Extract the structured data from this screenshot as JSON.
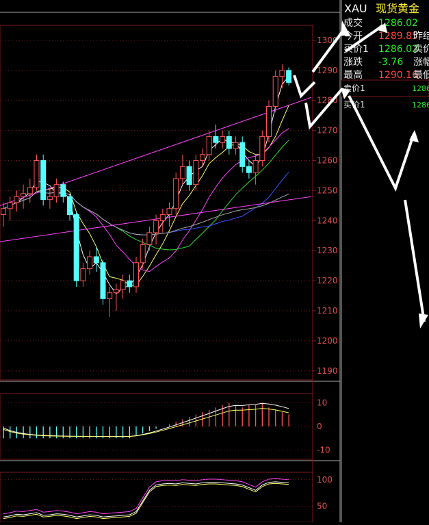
{
  "quote_panel": {
    "symbol": "XAU",
    "name": "现货黄金",
    "rows": [
      {
        "label": "成交",
        "value": "1286.02",
        "value_color": "#22ee22",
        "label2": ""
      },
      {
        "label": "今开",
        "value": "1289.85",
        "value_color": "#ff4444",
        "label2": "昨结"
      },
      {
        "label": "买价1",
        "value": "1286.02",
        "value_color": "#22ee22",
        "label2": "卖价"
      },
      {
        "label": "涨跌",
        "value": "-3.76",
        "value_color": "#22ee22",
        "label2": "涨幅"
      },
      {
        "label": "最高",
        "value": "1290.16",
        "value_color": "#ff4444",
        "label2": "最低"
      }
    ],
    "orders": [
      {
        "label": "卖价1",
        "value": "1286"
      },
      {
        "label": "买价1",
        "value": "1286"
      }
    ]
  },
  "price_axis": [
    "1300",
    "1290",
    "1280",
    "1270",
    "1260",
    "1250",
    "1240",
    "1230",
    "1220",
    "1210",
    "1200",
    "1190"
  ],
  "macd_axis": [
    "10",
    "0",
    "-10"
  ],
  "kdj_axis": [
    "100",
    "50"
  ],
  "colors": {
    "up": "#ff5555",
    "down": "#55ffff",
    "grid": "#7a1a1a",
    "axis_text": "#e05050",
    "ma_fast": "#ffffff",
    "ma_mid": "#ffff66",
    "ma_slow": "#ff44ff",
    "ma_green": "#33dd33",
    "ma_blue": "#3355ff",
    "ma_gray": "#aaaaaa",
    "trendline": "#ff44ff"
  },
  "chart_data": {
    "type": "candlestick",
    "ylim": [
      1187,
      1305
    ],
    "candles": [
      [
        1242,
        1246,
        1238,
        1244
      ],
      [
        1244,
        1248,
        1240,
        1246
      ],
      [
        1246,
        1250,
        1243,
        1248
      ],
      [
        1248,
        1252,
        1244,
        1249
      ],
      [
        1249,
        1254,
        1246,
        1251
      ],
      [
        1251,
        1262,
        1250,
        1260
      ],
      [
        1260,
        1262,
        1245,
        1247
      ],
      [
        1247,
        1251,
        1244,
        1248
      ],
      [
        1248,
        1254,
        1246,
        1252
      ],
      [
        1252,
        1253,
        1246,
        1248
      ],
      [
        1248,
        1249,
        1240,
        1242
      ],
      [
        1242,
        1243,
        1218,
        1220
      ],
      [
        1220,
        1226,
        1218,
        1224
      ],
      [
        1224,
        1230,
        1222,
        1228
      ],
      [
        1228,
        1231,
        1223,
        1226
      ],
      [
        1226,
        1227,
        1212,
        1214
      ],
      [
        1214,
        1218,
        1208,
        1216
      ],
      [
        1216,
        1219,
        1210,
        1217
      ],
      [
        1217,
        1222,
        1214,
        1220
      ],
      [
        1220,
        1222,
        1216,
        1218
      ],
      [
        1218,
        1228,
        1216,
        1226
      ],
      [
        1226,
        1234,
        1224,
        1232
      ],
      [
        1232,
        1238,
        1230,
        1236
      ],
      [
        1236,
        1242,
        1232,
        1240
      ],
      [
        1240,
        1244,
        1236,
        1242
      ],
      [
        1242,
        1246,
        1238,
        1244
      ],
      [
        1244,
        1256,
        1242,
        1254
      ],
      [
        1254,
        1262,
        1252,
        1258
      ],
      [
        1258,
        1260,
        1250,
        1252
      ],
      [
        1252,
        1262,
        1250,
        1260
      ],
      [
        1260,
        1264,
        1258,
        1262
      ],
      [
        1262,
        1270,
        1260,
        1268
      ],
      [
        1268,
        1272,
        1264,
        1266
      ],
      [
        1266,
        1270,
        1264,
        1268
      ],
      [
        1268,
        1270,
        1262,
        1264
      ],
      [
        1264,
        1268,
        1262,
        1266
      ],
      [
        1266,
        1268,
        1256,
        1258
      ],
      [
        1258,
        1260,
        1254,
        1256
      ],
      [
        1256,
        1262,
        1252,
        1260
      ],
      [
        1260,
        1270,
        1258,
        1268
      ],
      [
        1268,
        1280,
        1266,
        1278
      ],
      [
        1278,
        1290,
        1276,
        1288
      ],
      [
        1288,
        1292,
        1284,
        1290
      ],
      [
        1290,
        1291,
        1285,
        1286
      ]
    ],
    "macd_hist": [
      -5,
      -5,
      -5,
      -5,
      -5,
      -5,
      -5,
      -5,
      -5,
      -5,
      -5,
      -5,
      -5,
      -5,
      -5,
      -5,
      -5,
      -5,
      -5,
      -5,
      -4,
      -3,
      -2,
      -1,
      0,
      1,
      2,
      3,
      4,
      5,
      6,
      7,
      8,
      9,
      10,
      9,
      8,
      9,
      9,
      10,
      8,
      7,
      6,
      5
    ],
    "macd_axis_range": [
      -13,
      13
    ],
    "kdj_axis_range": [
      20,
      110
    ]
  }
}
